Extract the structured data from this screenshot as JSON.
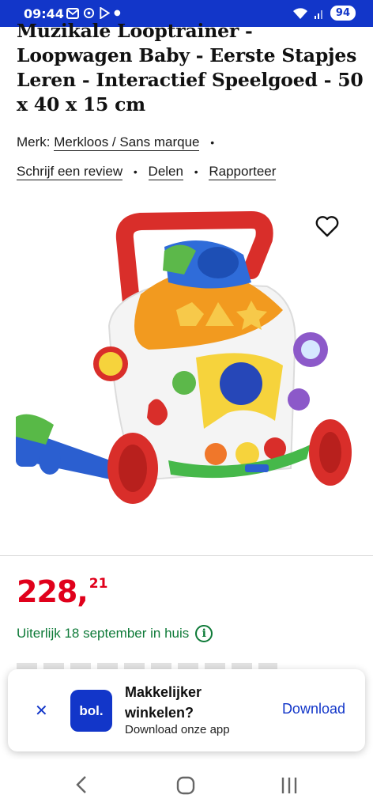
{
  "status_bar": {
    "time": "09:44",
    "battery": "94"
  },
  "product": {
    "title": "Muzikale Looptrainer - Loopwagen Baby - Eerste Stapjes Leren - Interactief Speelgoed - 50 x 40 x 15 cm",
    "brand_label": "Merk:",
    "brand_value": "Merkloos / Sans marque",
    "links": {
      "review": "Schrijf een review",
      "share": "Delen",
      "report": "Rapporteer"
    },
    "price_integer": "228,",
    "price_decimal": "21",
    "delivery": "Uiterlijk 18 september in huis"
  },
  "app_banner": {
    "logo_text": "bol.",
    "title": "Makkelijker winkelen?",
    "subtitle": "Download onze app",
    "download_label": "Download"
  },
  "colors": {
    "brand_blue": "#1236c9",
    "price_red": "#e0001b",
    "delivery_green": "#0e7a38"
  },
  "icons": [
    "mail-icon",
    "sync-icon",
    "play-icon",
    "wifi-icon",
    "signal-icon",
    "heart-icon",
    "info-icon",
    "close-icon",
    "back-icon",
    "home-icon",
    "recent-apps-icon"
  ]
}
